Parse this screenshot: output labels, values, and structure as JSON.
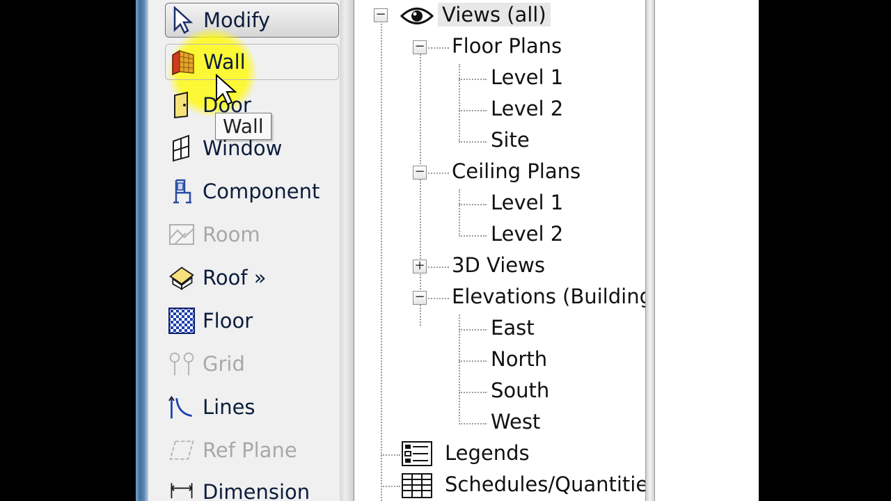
{
  "toolbar": {
    "items": [
      {
        "label": "Modify",
        "icon": "arrow-cursor-icon",
        "state": "pressed"
      },
      {
        "label": "Wall",
        "icon": "wall-icon",
        "state": "hover"
      },
      {
        "label": "Door",
        "icon": "door-icon",
        "state": "normal"
      },
      {
        "label": "Window",
        "icon": "window-icon",
        "state": "normal"
      },
      {
        "label": "Component",
        "icon": "component-icon",
        "state": "normal"
      },
      {
        "label": "Room",
        "icon": "room-icon",
        "state": "disabled"
      },
      {
        "label": "Roof »",
        "icon": "roof-icon",
        "state": "normal"
      },
      {
        "label": "Floor",
        "icon": "floor-icon",
        "state": "normal"
      },
      {
        "label": "Grid",
        "icon": "grid-icon",
        "state": "disabled"
      },
      {
        "label": "Lines",
        "icon": "lines-icon",
        "state": "normal"
      },
      {
        "label": "Ref Plane",
        "icon": "ref-plane-icon",
        "state": "disabled"
      },
      {
        "label": "Dimension",
        "icon": "dimension-icon",
        "state": "normal"
      }
    ],
    "tooltip": "Wall",
    "highlight_color": "#fff200"
  },
  "browser": {
    "root": "Views (all)",
    "floor_plans": {
      "label": "Floor Plans",
      "items": [
        "Level 1",
        "Level 2",
        "Site"
      ]
    },
    "ceiling_plans": {
      "label": "Ceiling Plans",
      "items": [
        "Level 1",
        "Level 2"
      ]
    },
    "views_3d": {
      "label": "3D Views"
    },
    "elevations": {
      "label": "Elevations (Building",
      "items": [
        "East",
        "North",
        "South",
        "West"
      ]
    },
    "legends": "Legends",
    "schedules": "Schedules/Quantitie"
  }
}
